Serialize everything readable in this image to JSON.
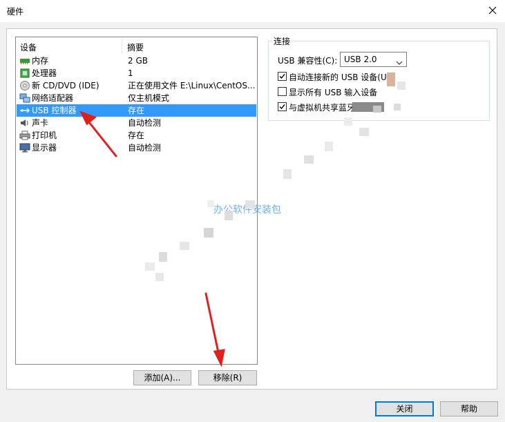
{
  "window": {
    "title": "硬件"
  },
  "devices": {
    "headers": {
      "device": "设备",
      "summary": "摘要"
    },
    "rows": [
      {
        "icon": "memory-icon",
        "name": "内存",
        "summary": "2 GB",
        "selected": false
      },
      {
        "icon": "processor-icon",
        "name": "处理器",
        "summary": "1",
        "selected": false
      },
      {
        "icon": "cd-dvd-icon",
        "name": "新 CD/DVD (IDE)",
        "summary": "正在使用文件 E:\\Linux\\CentOS...",
        "selected": false
      },
      {
        "icon": "network-adapter-icon",
        "name": "网络适配器",
        "summary": "仅主机模式",
        "selected": false
      },
      {
        "icon": "usb-icon",
        "name": "USB 控制器",
        "summary": "存在",
        "selected": true
      },
      {
        "icon": "sound-card-icon",
        "name": "声卡",
        "summary": "自动检测",
        "selected": false
      },
      {
        "icon": "printer-icon",
        "name": "打印机",
        "summary": "存在",
        "selected": false
      },
      {
        "icon": "display-icon",
        "name": "显示器",
        "summary": "自动检测",
        "selected": false
      }
    ]
  },
  "buttons": {
    "add": "添加(A)...",
    "remove": "移除(R)",
    "close": "关闭",
    "help": "帮助"
  },
  "connection": {
    "group_title": "连接",
    "compat_label": "USB 兼容性(C):",
    "compat_value": "USB 2.0",
    "checkboxes": [
      {
        "label": "自动连接新的 USB 设备(U)",
        "checked": true
      },
      {
        "label": "显示所有 USB 输入设备",
        "checked": false
      },
      {
        "label": "与虚拟机共享蓝牙",
        "checked": true
      }
    ]
  },
  "watermark": "办公软件安装包",
  "colors": {
    "selection": "#3399ff",
    "accent_border": "#0078d7",
    "arrow": "#e0201c",
    "watermark": "#6fb1e8"
  }
}
